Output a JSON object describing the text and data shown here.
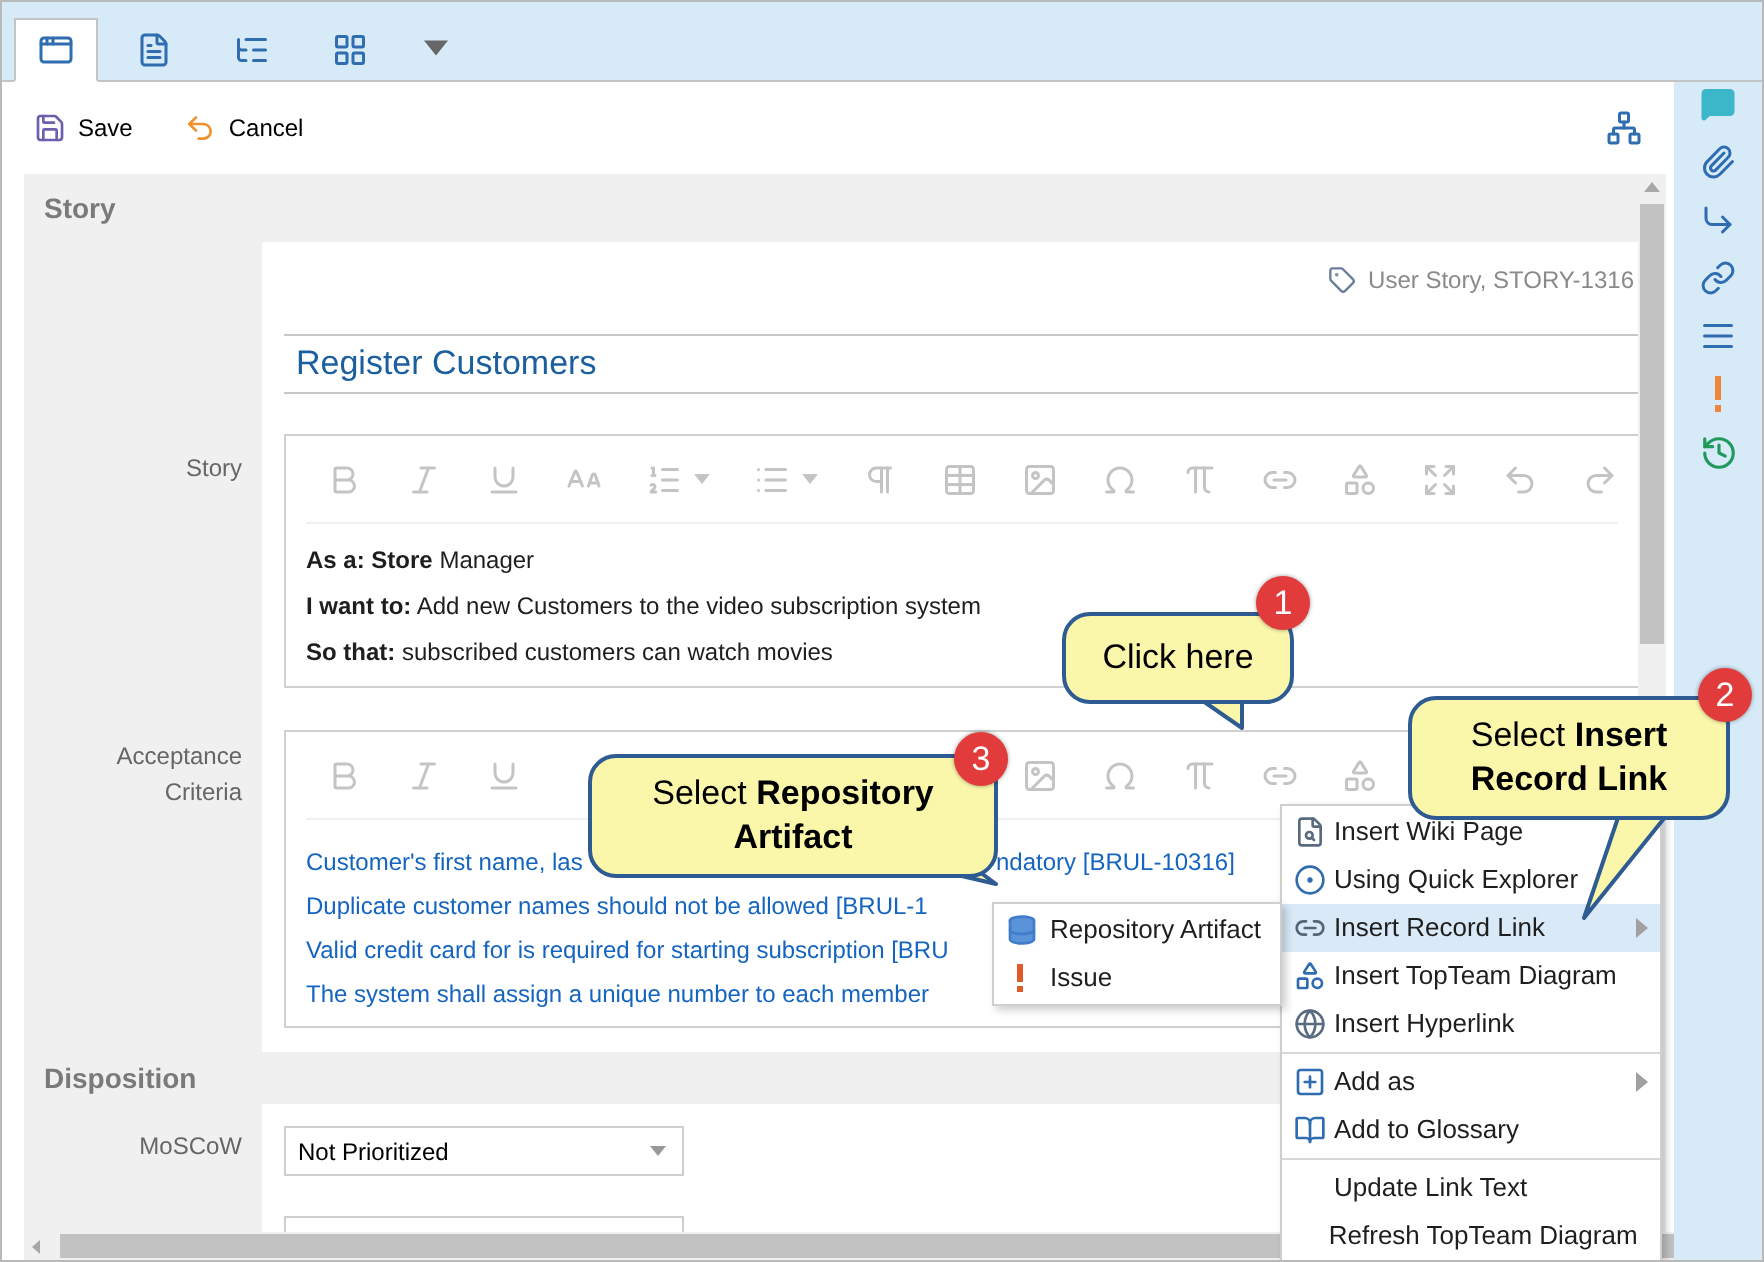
{
  "tabs": [
    {
      "selected": true
    },
    {
      "selected": false
    },
    {
      "selected": false
    },
    {
      "selected": false
    }
  ],
  "toolbar": {
    "save": "Save",
    "cancel": "Cancel"
  },
  "story_section": {
    "heading": "Story",
    "record_type": "User Story, STORY-1316",
    "title": "Register Customers",
    "story_label": "Story",
    "story_lines": [
      "**As a: Store** Manager",
      "**I want to:** Add new Customers to the video subscription system",
      "**So that:** subscribed customers can watch movies"
    ],
    "acceptance_label": "Acceptance Criteria",
    "acceptance_lines": [
      {
        "parts": [
          "Customer's first name, las",
          "ndatory [BRUL-10316]"
        ]
      },
      {
        "parts": [
          "Duplicate customer names should not be allowed [BRUL-1"
        ]
      },
      {
        "parts": [
          "Valid credit card for is required for starting subscription [BRU"
        ]
      },
      {
        "parts": [
          "The system shall assign a unique number to each member"
        ]
      }
    ]
  },
  "disposition": {
    "heading": "Disposition",
    "fields": [
      {
        "label": "MoSCoW",
        "value": "Not Prioritized"
      }
    ]
  },
  "context_menu": {
    "groups": [
      {
        "items": [
          {
            "label": "Insert Wiki Page",
            "selected": false,
            "submenu": false
          },
          {
            "label": "Using Quick Explorer",
            "selected": false,
            "submenu": false
          },
          {
            "label": "Insert Record Link",
            "selected": true,
            "submenu": true
          },
          {
            "label": "Insert TopTeam Diagram",
            "selected": false,
            "submenu": false
          },
          {
            "label": "Insert Hyperlink",
            "selected": false,
            "submenu": false
          }
        ]
      },
      {
        "items": [
          {
            "label": "Add as",
            "selected": false,
            "submenu": true
          },
          {
            "label": "Add to Glossary",
            "selected": false,
            "submenu": false
          }
        ]
      },
      {
        "items": [
          {
            "label": "Update Link Text",
            "selected": false,
            "submenu": false
          },
          {
            "label": "Refresh TopTeam Diagram",
            "selected": false,
            "submenu": false
          }
        ]
      }
    ]
  },
  "submenu": {
    "items": [
      {
        "label": "Repository Artifact"
      },
      {
        "label": "Issue"
      }
    ]
  },
  "callouts": [
    {
      "number": "1",
      "text": "Click here"
    },
    {
      "number": "2",
      "text": "Select **Insert Record Link**"
    },
    {
      "number": "3",
      "text": "Select **Repository Artifact**"
    }
  ]
}
